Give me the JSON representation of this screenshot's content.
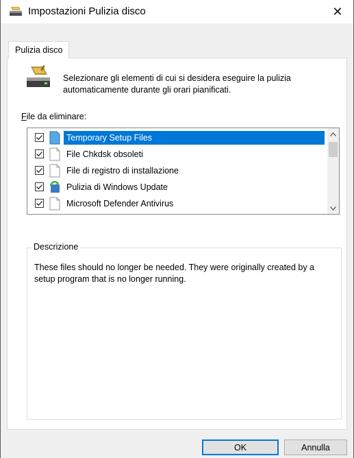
{
  "window": {
    "title": "Impostazioni Pulizia disco",
    "close_glyph": "✕"
  },
  "tabs": [
    {
      "label": "Pulizia disco",
      "selected": true
    }
  ],
  "intro": {
    "text": "Selezionare gli elementi di cui si desidera eseguire la pulizia automaticamente durante gli orari pianificati.",
    "icon": "disk-cleanup-icon"
  },
  "files": {
    "label_prefix": "F",
    "label_rest": "ile da eliminare:",
    "items": [
      {
        "label": "Temporary Setup Files",
        "checked": true,
        "selected": true,
        "icon": "blue-file-icon"
      },
      {
        "label": "File Chkdsk obsoleti",
        "checked": true,
        "selected": false,
        "icon": "blank-file-icon"
      },
      {
        "label": "File di registro di installazione",
        "checked": true,
        "selected": false,
        "icon": "blank-file-icon"
      },
      {
        "label": "Pulizia di Windows Update",
        "checked": true,
        "selected": false,
        "icon": "windows-update-icon"
      },
      {
        "label": "Microsoft Defender Antivirus",
        "checked": true,
        "selected": false,
        "icon": "blank-file-icon"
      }
    ]
  },
  "description": {
    "legend": "Descrizione",
    "text": "These files should no longer be needed. They were originally created by a setup program that is no longer running."
  },
  "buttons": {
    "ok": "OK",
    "cancel": "Annulla"
  },
  "colors": {
    "selection": "#0078d7",
    "panel_bg": "#ffffff",
    "dialog_bg": "#f0f0f0"
  }
}
